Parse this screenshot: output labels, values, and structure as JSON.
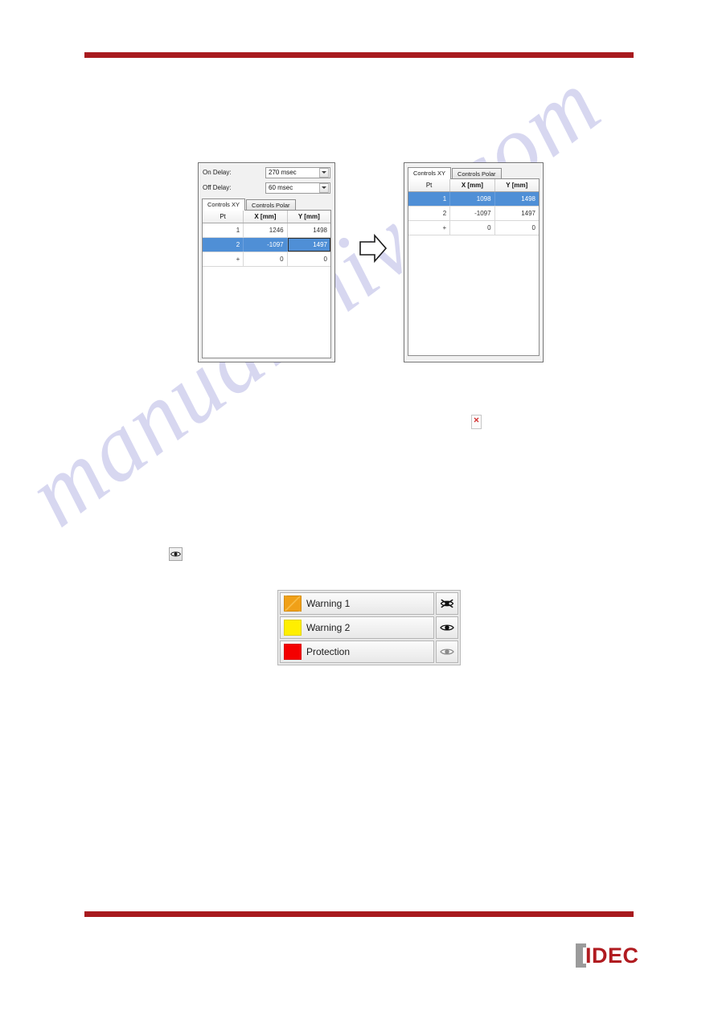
{
  "page": {
    "rule_color": "#a81a1e",
    "watermark_text": "manualshive.com"
  },
  "left_panel": {
    "on_delay": {
      "label": "On Delay:",
      "value": "270 msec"
    },
    "off_delay": {
      "label": "Off Delay:",
      "value": "60 msec"
    },
    "tabs": [
      {
        "label": "Controls XY",
        "active": true
      },
      {
        "label": "Controls Polar",
        "active": false
      }
    ],
    "table": {
      "headers": [
        "Pt",
        "X [mm]",
        "Y [mm]"
      ],
      "rows": [
        {
          "pt": "1",
          "x": "1246",
          "y": "1498",
          "selected": false
        },
        {
          "pt": "2",
          "x": "-1097",
          "y": "1497",
          "selected": true
        },
        {
          "pt": "+",
          "x": "0",
          "y": "0",
          "selected": false
        }
      ]
    }
  },
  "right_panel": {
    "tabs": [
      {
        "label": "Controls XY",
        "active": true
      },
      {
        "label": "Controls Polar",
        "active": false
      }
    ],
    "table": {
      "headers": [
        "Pt",
        "X [mm]",
        "Y [mm]"
      ],
      "rows": [
        {
          "pt": "1",
          "x": "1098",
          "y": "1498",
          "selected": true
        },
        {
          "pt": "2",
          "x": "-1097",
          "y": "1497",
          "selected": false
        },
        {
          "pt": "+",
          "x": "0",
          "y": "0",
          "selected": false
        }
      ]
    }
  },
  "flow_arrow": {
    "icon": "arrow-right-outline-icon"
  },
  "broken_image": {
    "icon": "broken-image-placeholder-icon"
  },
  "eye_button": {
    "icon": "eye-icon"
  },
  "zone_list": {
    "rows": [
      {
        "label": "Warning 1",
        "color": "#f0a018",
        "eye_icon": "eye-crossed-icon",
        "eye_state": "hidden"
      },
      {
        "label": "Warning 2",
        "color": "#ffef00",
        "eye_icon": "eye-icon",
        "eye_state": "visible"
      },
      {
        "label": "Protection",
        "color": "#f40000",
        "eye_icon": "eye-icon-disabled",
        "eye_state": "disabled"
      }
    ]
  },
  "footer": {
    "logo_text": "IDEC",
    "logo_color": "#b01b20"
  }
}
